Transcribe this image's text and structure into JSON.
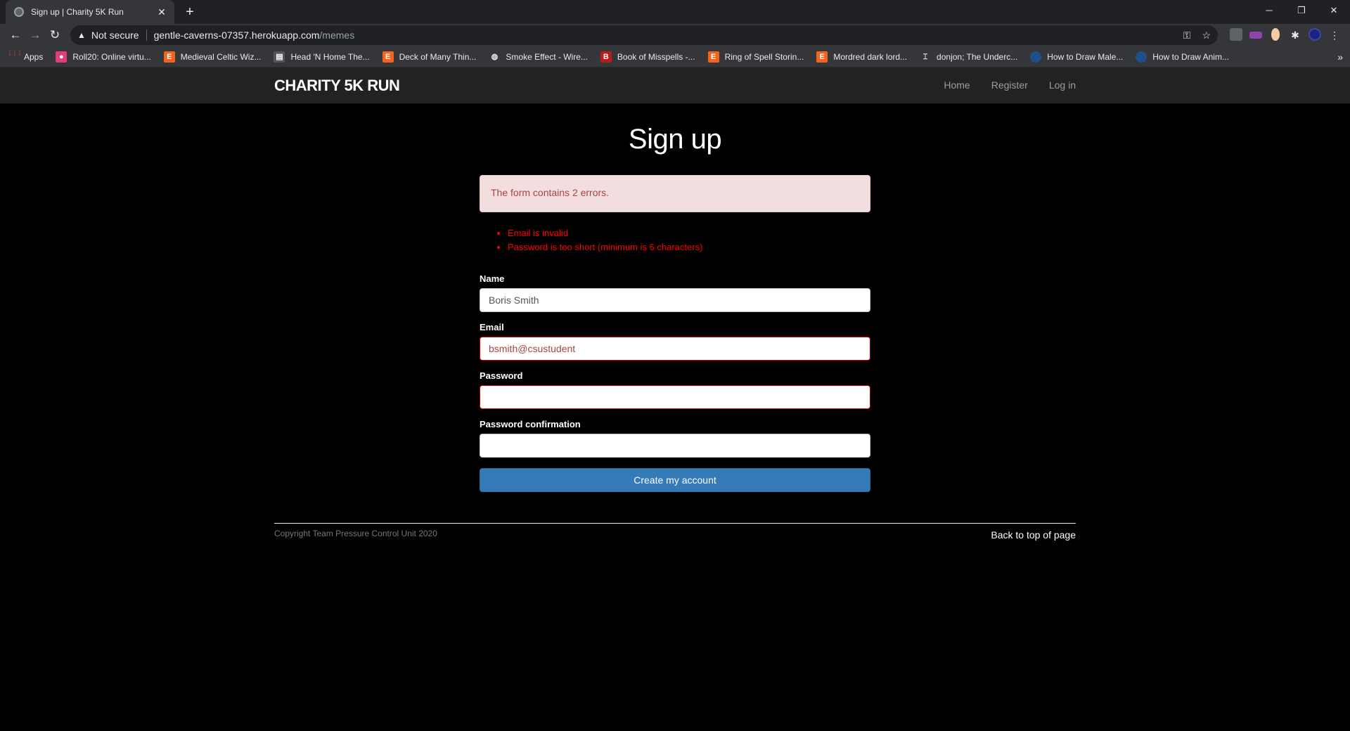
{
  "browser": {
    "tab_title": "Sign up | Charity 5K Run",
    "security_label": "Not secure",
    "url_host": "gentle-caverns-07357.herokuapp.com",
    "url_path": "/memes",
    "bookmarks": [
      {
        "label": "Apps",
        "icon": "apps-grid-icon"
      },
      {
        "label": "Roll20: Online virtu...",
        "icon": "roll20-icon"
      },
      {
        "label": "Medieval Celtic Wiz...",
        "icon": "etsy-icon"
      },
      {
        "label": "Head 'N Home The...",
        "icon": "site-icon"
      },
      {
        "label": "Deck of Many Thin...",
        "icon": "etsy-icon"
      },
      {
        "label": "Smoke Effect - Wire...",
        "icon": "globe-icon"
      },
      {
        "label": "Book of Misspells -...",
        "icon": "b-icon"
      },
      {
        "label": "Ring of Spell Storin...",
        "icon": "etsy-icon"
      },
      {
        "label": "Mordred dark lord...",
        "icon": "etsy-icon"
      },
      {
        "label": "donjon; The Underc...",
        "icon": "donjon-icon"
      },
      {
        "label": "How to Draw Male...",
        "icon": "circle-icon"
      },
      {
        "label": "How to Draw Anim...",
        "icon": "circle-icon"
      }
    ]
  },
  "nav": {
    "brand": "CHARITY 5K RUN",
    "links": [
      "Home",
      "Register",
      "Log in"
    ]
  },
  "page": {
    "title": "Sign up",
    "alert": "The form contains 2 errors.",
    "errors": [
      "Email is invalid",
      "Password is too short (minimum is 6 characters)"
    ],
    "form": {
      "name_label": "Name",
      "name_value": "Boris Smith",
      "email_label": "Email",
      "email_value": "bsmith@csustudent",
      "password_label": "Password",
      "password_value": "",
      "confirmation_label": "Password confirmation",
      "confirmation_value": "",
      "submit_label": "Create my account"
    }
  },
  "footer": {
    "copyright": "Copyright Team Pressure Control Unit 2020",
    "back_to_top": "Back to top of page"
  },
  "colors": {
    "button": "#337ab7",
    "alert_bg": "#f2dede",
    "alert_text": "#a94442",
    "error_text": "#ff0000"
  }
}
